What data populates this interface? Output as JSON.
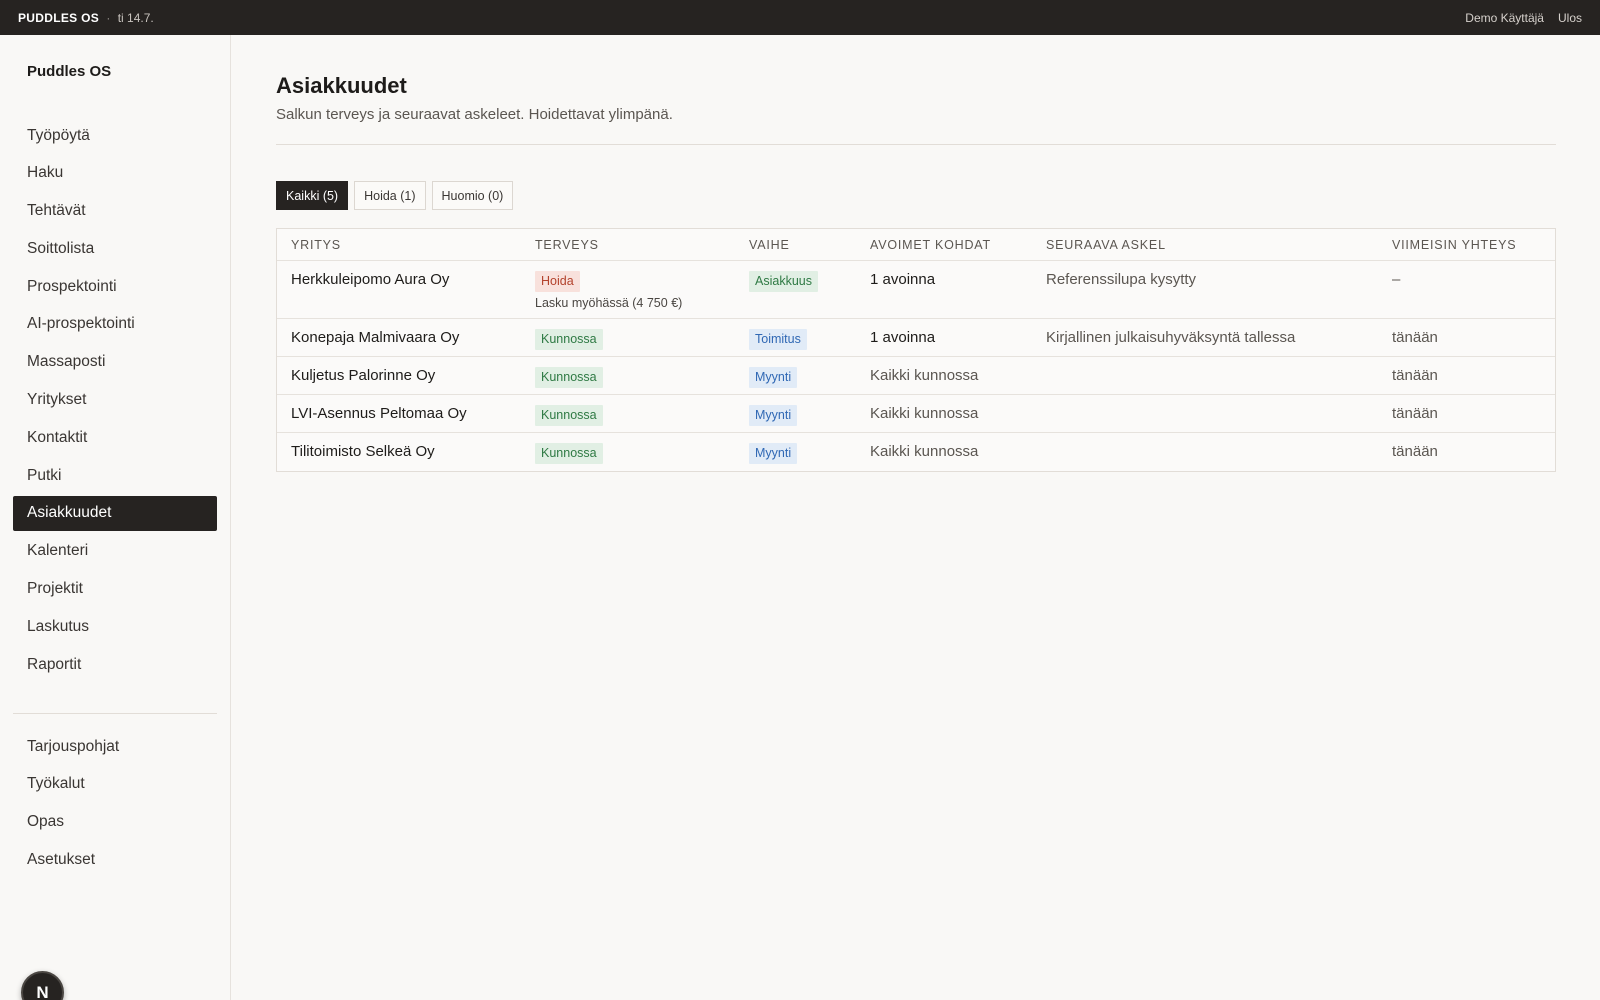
{
  "topbar": {
    "brand": "PUDDLES OS",
    "separator": "·",
    "date": "ti 14.7.",
    "user": "Demo Käyttäjä",
    "logout": "Ulos"
  },
  "sidebar": {
    "logo": "Puddles OS",
    "items": [
      {
        "label": "Työpöytä"
      },
      {
        "label": "Haku"
      },
      {
        "label": "Tehtävät"
      },
      {
        "label": "Soittolista"
      },
      {
        "label": "Prospektointi"
      },
      {
        "label": "AI-prospektointi"
      },
      {
        "label": "Massaposti"
      },
      {
        "label": "Yritykset"
      },
      {
        "label": "Kontaktit"
      },
      {
        "label": "Putki"
      },
      {
        "label": "Asiakkuudet",
        "active": true
      },
      {
        "label": "Kalenteri"
      },
      {
        "label": "Projektit"
      },
      {
        "label": "Laskutus"
      },
      {
        "label": "Raportit"
      }
    ],
    "secondary_items": [
      {
        "label": "Tarjouspohjat"
      },
      {
        "label": "Työkalut"
      },
      {
        "label": "Opas"
      },
      {
        "label": "Asetukset"
      }
    ],
    "fab_label": "N"
  },
  "main": {
    "title": "Asiakkuudet",
    "subtitle": "Salkun terveys ja seuraavat askeleet. Hoidettavat ylimpänä.",
    "filters": [
      {
        "label": "Kaikki (5)",
        "active": true
      },
      {
        "label": "Hoida (1)"
      },
      {
        "label": "Huomio (0)"
      }
    ],
    "table": {
      "headers": [
        "YRITYS",
        "TERVEYS",
        "VAIHE",
        "AVOIMET KOHDAT",
        "SEURAAVA ASKEL",
        "VIIMEISIN YHTEYS"
      ],
      "rows": [
        {
          "company": "Herkkuleipomo Aura Oy",
          "health": "Hoida",
          "health_note": "Lasku myöhässä (4 750 €)",
          "stage": "Asiakkuus",
          "open_items": "1 avoinna",
          "next_step": "Referenssilupa kysytty",
          "last_contact": "–"
        },
        {
          "company": "Konepaja Malmivaara Oy",
          "health": "Kunnossa",
          "stage": "Toimitus",
          "open_items": "1 avoinna",
          "next_step": "Kirjallinen julkaisuhyväksyntä tallessa",
          "last_contact": "tänään"
        },
        {
          "company": "Kuljetus Palorinne Oy",
          "health": "Kunnossa",
          "stage": "Myynti",
          "open_items": "Kaikki kunnossa",
          "next_step": "",
          "last_contact": "tänään"
        },
        {
          "company": "LVI-Asennus Peltomaa Oy",
          "health": "Kunnossa",
          "stage": "Myynti",
          "open_items": "Kaikki kunnossa",
          "next_step": "",
          "last_contact": "tänään"
        },
        {
          "company": "Tilitoimisto Selkeä Oy",
          "health": "Kunnossa",
          "stage": "Myynti",
          "open_items": "Kaikki kunnossa",
          "next_step": "",
          "last_contact": "tänään"
        }
      ]
    }
  },
  "colors": {
    "dark": "#262321",
    "background": "#f9f8f6",
    "badge_red_bg": "#f8e1dc",
    "badge_red_fg": "#b3422c",
    "badge_green_bg": "#e1efe4",
    "badge_green_fg": "#2f7a44",
    "badge_blue_bg": "#e1ebf7",
    "badge_blue_fg": "#3068b4"
  }
}
